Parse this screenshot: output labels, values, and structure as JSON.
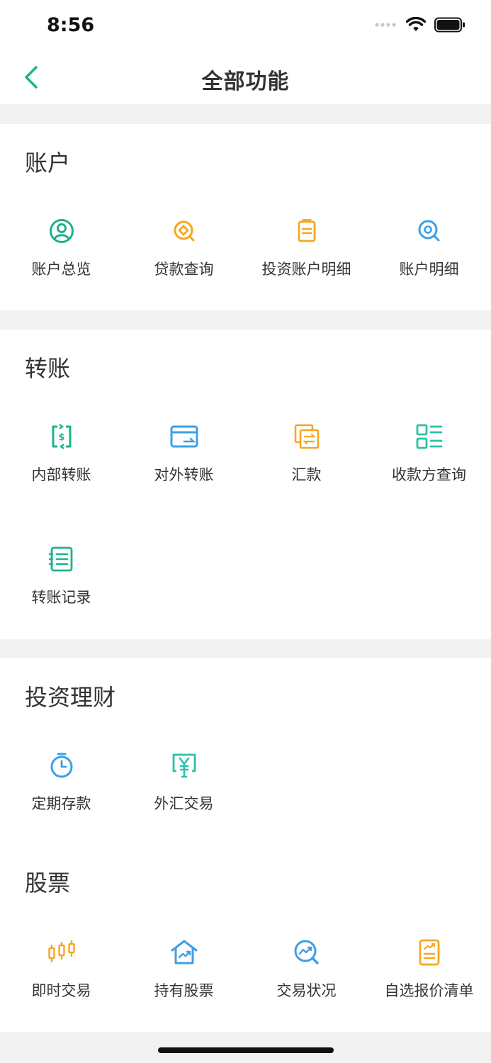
{
  "status": {
    "time": "8:56"
  },
  "nav": {
    "title": "全部功能"
  },
  "sections": {
    "account": {
      "title": "账户",
      "items": [
        "账户总览",
        "贷款查询",
        "投资账户明细",
        "账户明细"
      ]
    },
    "transfer": {
      "title": "转账",
      "items": [
        "内部转账",
        "对外转账",
        "汇款",
        "收款方查询",
        "转账记录"
      ]
    },
    "investment": {
      "title": "投资理财",
      "items": [
        "定期存款",
        "外汇交易"
      ]
    },
    "stock": {
      "title": "股票",
      "items": [
        "即时交易",
        "持有股票",
        "交易状况",
        "自选报价清单"
      ]
    }
  },
  "icons": {
    "account-overview": "user-circle-icon",
    "loan-query": "loan-search-icon",
    "investment-detail": "clipboard-icon",
    "account-detail": "search-icon",
    "internal-transfer": "dollar-transfer-icon",
    "external-transfer": "card-icon",
    "remittance": "exchange-docs-icon",
    "payee-query": "grid-list-icon",
    "transfer-records": "list-icon",
    "time-deposit": "stopwatch-icon",
    "forex-trade": "yen-screen-icon",
    "instant-trade": "candlestick-icon",
    "holdings": "house-chart-icon",
    "trade-status": "chart-search-icon",
    "watchlist": "report-icon"
  },
  "colors": {
    "green": "#1fb28a",
    "orange": "#f5a623",
    "blue": "#3ba0e6",
    "teal": "#2cc0a6"
  }
}
